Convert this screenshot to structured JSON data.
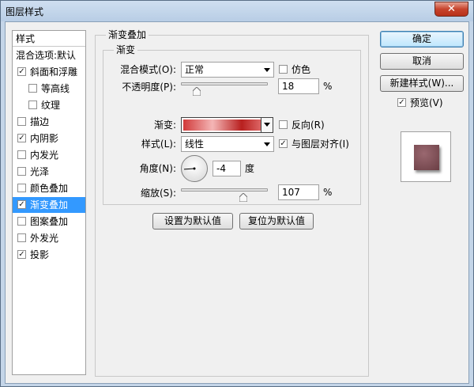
{
  "window": {
    "title": "图层样式",
    "close_label": "✕"
  },
  "sidebar": {
    "header": "样式",
    "items": [
      {
        "label": "混合选项:默认",
        "checkbox": false,
        "checked": false,
        "selected": false,
        "indent": false
      },
      {
        "label": "斜面和浮雕",
        "checkbox": true,
        "checked": true,
        "selected": false,
        "indent": false
      },
      {
        "label": "等高线",
        "checkbox": true,
        "checked": false,
        "selected": false,
        "indent": true
      },
      {
        "label": "纹理",
        "checkbox": true,
        "checked": false,
        "selected": false,
        "indent": true
      },
      {
        "label": "描边",
        "checkbox": true,
        "checked": false,
        "selected": false,
        "indent": false
      },
      {
        "label": "内阴影",
        "checkbox": true,
        "checked": true,
        "selected": false,
        "indent": false
      },
      {
        "label": "内发光",
        "checkbox": true,
        "checked": false,
        "selected": false,
        "indent": false
      },
      {
        "label": "光泽",
        "checkbox": true,
        "checked": false,
        "selected": false,
        "indent": false
      },
      {
        "label": "颜色叠加",
        "checkbox": true,
        "checked": false,
        "selected": false,
        "indent": false
      },
      {
        "label": "渐变叠加",
        "checkbox": true,
        "checked": true,
        "selected": true,
        "indent": false
      },
      {
        "label": "图案叠加",
        "checkbox": true,
        "checked": false,
        "selected": false,
        "indent": false
      },
      {
        "label": "外发光",
        "checkbox": true,
        "checked": false,
        "selected": false,
        "indent": false
      },
      {
        "label": "投影",
        "checkbox": true,
        "checked": true,
        "selected": false,
        "indent": false
      }
    ]
  },
  "panel": {
    "group_title": "渐变叠加",
    "subgroup_title": "渐变",
    "blend_mode": {
      "label": "混合模式(O):",
      "value": "正常"
    },
    "dither": {
      "label": "仿色",
      "checked": false
    },
    "opacity": {
      "label": "不透明度(P):",
      "value": "18",
      "unit": "%",
      "fraction": 0.18
    },
    "gradient": {
      "label": "渐变:",
      "stops": [
        "#d13a3a",
        "#f4b6b6",
        "#b8201f",
        "#f08a8a"
      ]
    },
    "reverse": {
      "label": "反向(R)",
      "checked": false
    },
    "style": {
      "label": "样式(L):",
      "value": "线性"
    },
    "align_layer": {
      "label": "与图层对齐(I)",
      "checked": true
    },
    "angle": {
      "label": "角度(N):",
      "value": "-4",
      "unit": "度",
      "degrees": -4
    },
    "scale": {
      "label": "缩放(S):",
      "value": "107",
      "unit": "%",
      "fraction": 0.714
    },
    "make_default": "设置为默认值",
    "reset_default": "复位为默认值"
  },
  "actions": {
    "ok": "确定",
    "cancel": "取消",
    "new_style": "新建样式(W)...",
    "preview_label": "预览(V)",
    "preview_checked": true
  },
  "colors": {
    "selection": "#3399ff",
    "preview_fill": "#7d5056"
  }
}
